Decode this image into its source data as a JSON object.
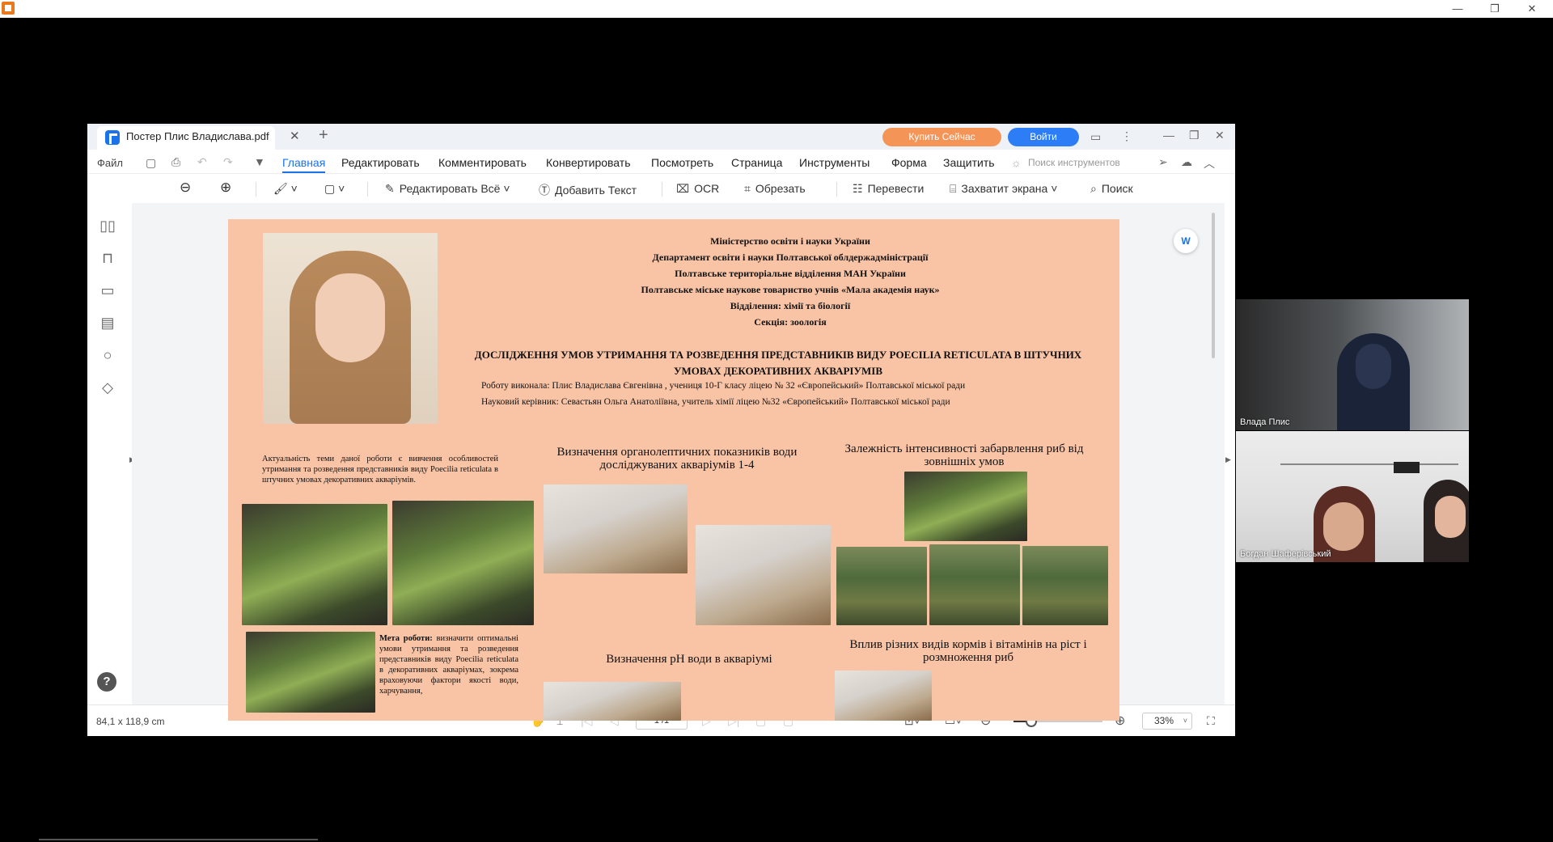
{
  "outer_window": {
    "minimize": "—",
    "restore": "❐",
    "close": "✕"
  },
  "app": {
    "tab_title": "Постер Плис Владислава.pdf",
    "tab_close": "✕",
    "tab_add": "+",
    "buy_label": "Купить Сейчас",
    "login_label": "Войти",
    "window_controls": {
      "minimize": "—",
      "restore": "❐",
      "close": "✕"
    }
  },
  "menu": {
    "file": "Файл",
    "items": [
      "Главная",
      "Редактировать",
      "Комментировать",
      "Конвертировать",
      "Посмотреть",
      "Страница",
      "Инструменты",
      "Форма",
      "Защитить"
    ],
    "active": "Главная",
    "tool_search_placeholder": "Поиск инструментов"
  },
  "toolbar": {
    "edit_all": "Редактировать Всё",
    "add_text": "Добавить Текст",
    "ocr": "OCR",
    "crop": "Обрезать",
    "translate": "Перевести",
    "capture": "Захватит экрана",
    "search": "Поиск"
  },
  "status": {
    "page_size": "84,1 x 118,9 cm",
    "page_indicator": "1 /1",
    "zoom_value": "33%",
    "zoom_fraction": 0.2
  },
  "poster": {
    "header_lines": [
      "Міністерство освіти і науки України",
      "Департамент освіти і науки Полтавської облдержадміністрації",
      "Полтавське територіальне відділення МАН України",
      "Полтавське міське наукове товариство учнів «Мала академія наук»",
      "Відділення: хімії та біології",
      "Секція: зоологія"
    ],
    "title": "ДОСЛІДЖЕННЯ УМОВ УТРИМАННЯ ТА РОЗВЕДЕННЯ ПРЕДСТАВНИКІВ ВИДУ POECILIA RETICULATA В ШТУЧНИХ УМОВАХ ДЕКОРАТИВНИХ АКВАРІУМІВ",
    "author": "Роботу виконала: Плис Владислава Євгенівна , учениця 10-Г класу ліцею № 32 «Європейський» Полтавської міської ради",
    "supervisor": "Науковий керівник: Севастьян Ольга Анатоліївна, учитель хімії ліцею №32 «Європейський» Полтавської міської ради",
    "relevance": "Актуальність теми даної роботи є вивчення особливостей утримання та розведення представників виду Poecilia reticulata в штучних умовах декоративних акваріумів.",
    "goal_label": "Мета роботи:",
    "goal_text": " визначити оптимальні умови утримання та розведення представників виду Poecilia reticulata в декоративних акваріумах, зокрема враховуючи фактори якості води, харчування,",
    "section_organoleptic": "Визначення органолептичних показників води досліджуваних акваріумів 1-4",
    "section_color": "Залежність інтенсивності забарвлення риб від зовнішніх умов",
    "section_ph": "Визначення рН води в акваріумі",
    "section_feed": "Вплив різних видів кормів і вітамінів  на ріст і розмноження риб"
  },
  "participants": [
    {
      "name": "Влада Плис"
    },
    {
      "name": "Богдан Шаферівський"
    }
  ]
}
